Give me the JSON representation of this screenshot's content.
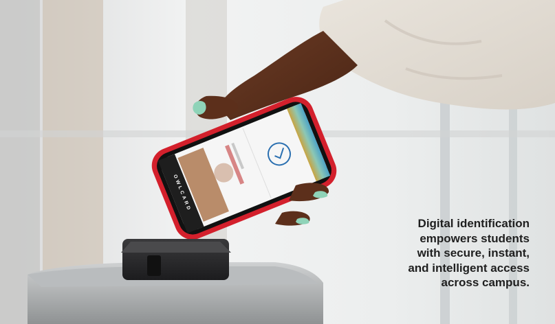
{
  "caption": {
    "lines": [
      "Digital identification",
      "empowers students",
      "with secure, instant,",
      "and intelligent access",
      "across campus."
    ]
  },
  "phone": {
    "brand_label": "OWLCARD"
  },
  "colors": {
    "nail_polish": "#8fd3b8",
    "phone_case": "#d3202c",
    "caption_text": "#1f1f1f",
    "background": "#eef0f1"
  }
}
